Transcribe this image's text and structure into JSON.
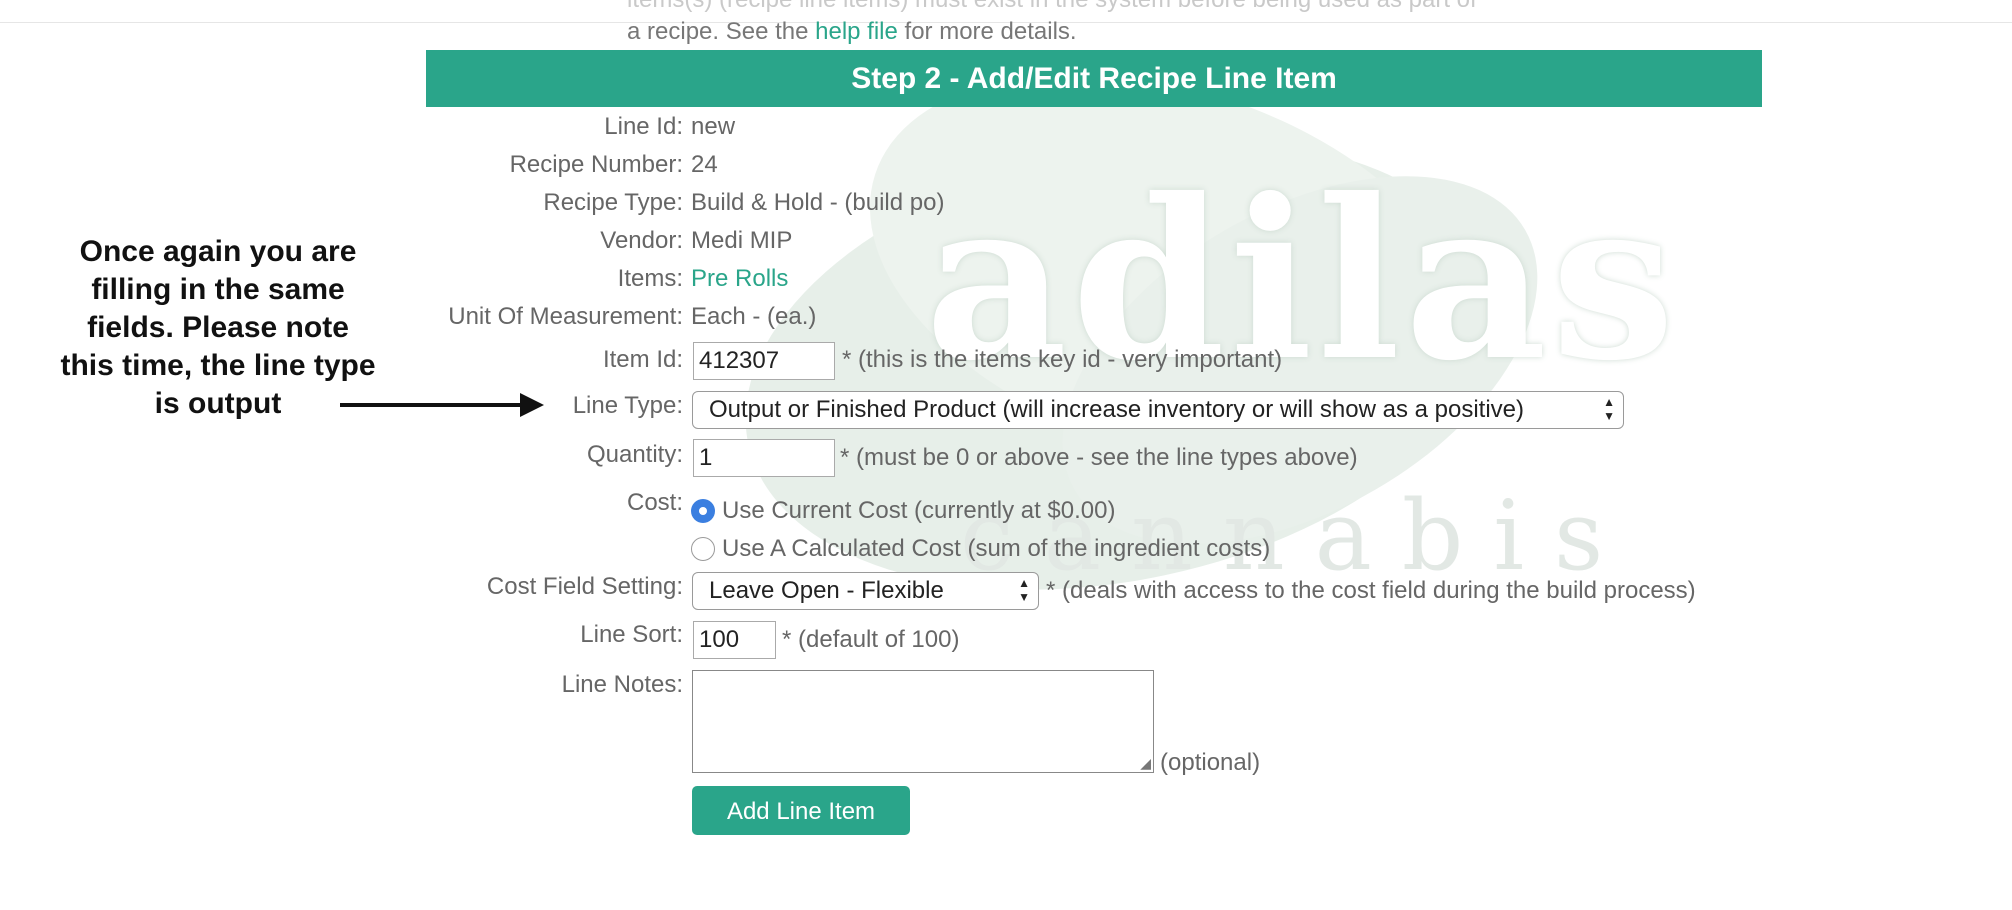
{
  "header_cut": {
    "line1": "items(s) (recipe line items) must exist in the system before being used as part of",
    "line2_prefix": "a recipe. See the ",
    "help_link": "help file",
    "line2_suffix": " for more details."
  },
  "watermark": {
    "word": "adilas",
    "sub": "cannabis"
  },
  "banner_title": "Step 2 - Add/Edit Recipe Line Item",
  "fields": {
    "line_id": {
      "label": "Line Id:",
      "value": "new"
    },
    "recipe_number": {
      "label": "Recipe Number:",
      "value": "24"
    },
    "recipe_type": {
      "label": "Recipe Type:",
      "value": "Build & Hold - (build po)"
    },
    "vendor": {
      "label": "Vendor:",
      "value": "Medi MIP"
    },
    "items": {
      "label": "Items:",
      "value": "Pre Rolls"
    },
    "uom": {
      "label": "Unit Of Measurement:",
      "value": "Each - (ea.)"
    },
    "item_id": {
      "label": "Item Id:",
      "value": "412307",
      "note": "* (this is the items key id - very important)"
    },
    "line_type": {
      "label": "Line Type:",
      "selected": "Output or Finished Product (will increase inventory or will show as a positive)"
    },
    "quantity": {
      "label": "Quantity:",
      "value": "1",
      "note": "* (must be 0 or above - see the line types above)"
    },
    "cost": {
      "label": "Cost:",
      "option1": "Use Current Cost (currently at $0.00)",
      "option2": "Use A Calculated Cost (sum of the ingredient costs)"
    },
    "cost_field_setting": {
      "label": "Cost Field Setting:",
      "selected": "Leave Open - Flexible",
      "note": "* (deals with access to the cost field during the build process)"
    },
    "line_sort": {
      "label": "Line Sort:",
      "value": "100",
      "note": "* (default of 100)"
    },
    "line_notes": {
      "label": "Line Notes:",
      "value": "",
      "note": "(optional)"
    }
  },
  "button_label": "Add Line Item",
  "annotation": "Once again you are filling in the same fields. Please note this time, the line type is output",
  "colors": {
    "accent": "#2aa58a",
    "radio_on": "#3b7fe0"
  }
}
